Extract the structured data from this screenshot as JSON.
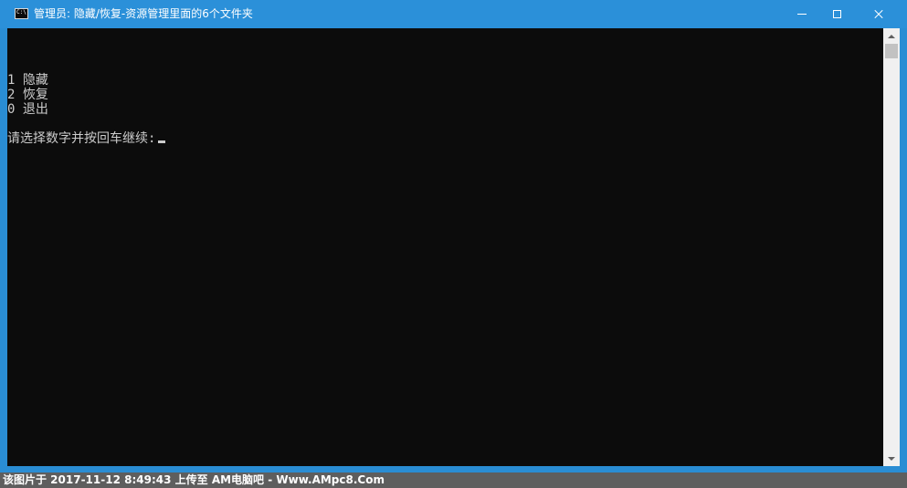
{
  "window": {
    "title": "管理员: 隐藏/恢复-资源管理里面的6个文件夹",
    "icon": "console-icon",
    "icon_text": "C:\\",
    "controls": {
      "minimize": "minimize-icon",
      "maximize": "maximize-icon",
      "close": "close-icon"
    }
  },
  "console": {
    "background": "#0c0c0c",
    "foreground": "#cccccc",
    "lines": [
      "1 隐藏",
      "2 恢复",
      "0 退出",
      "请选择数字并按回车继续:"
    ]
  },
  "watermark": {
    "text": "该图片于  2017-11-12  8:49:43  上传至  AM电脑吧  -  Www.AMpc8.Com"
  },
  "colors": {
    "titlebar": "#2b90d9",
    "scrollbar": "#f0f0f0",
    "watermark_bg": "#5e5e5e"
  }
}
